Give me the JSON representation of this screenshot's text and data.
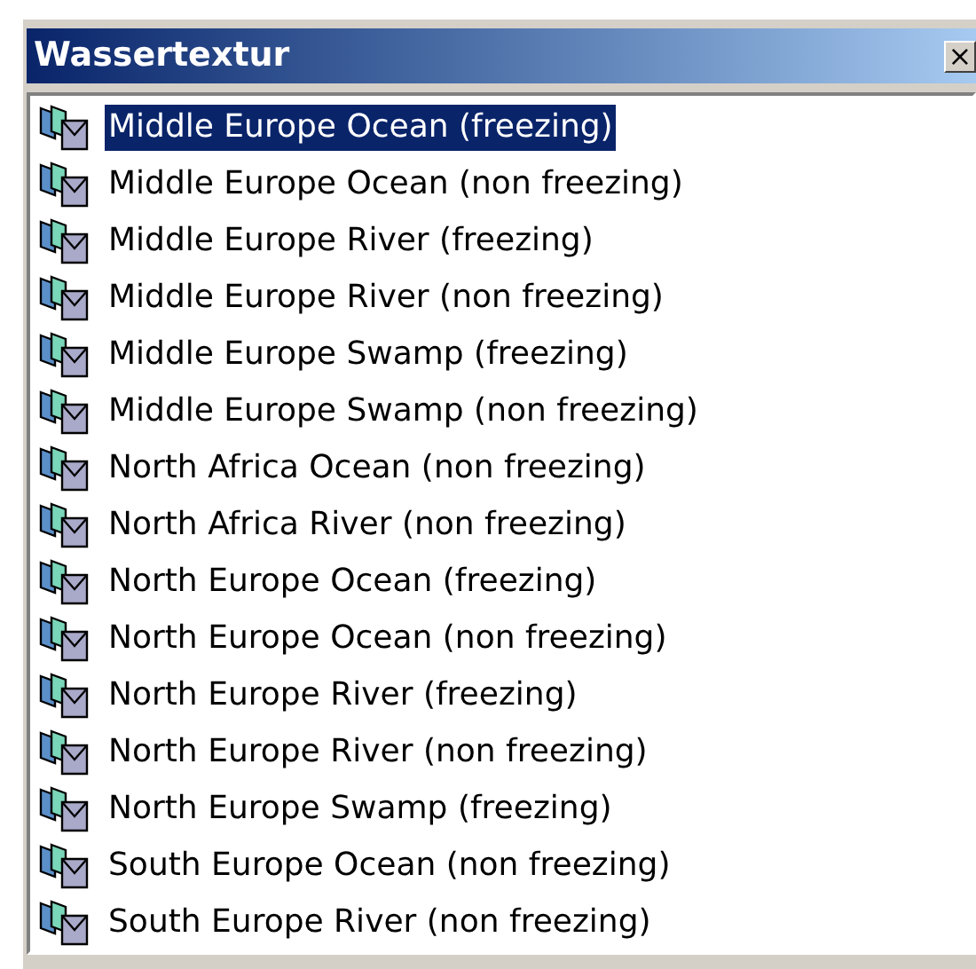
{
  "window": {
    "title": "Wassertextur",
    "close": "×"
  },
  "items": [
    {
      "label": "Middle Europe Ocean (freezing)",
      "selected": true
    },
    {
      "label": "Middle Europe Ocean (non freezing)",
      "selected": false
    },
    {
      "label": "Middle Europe River (freezing)",
      "selected": false
    },
    {
      "label": "Middle Europe River (non freezing)",
      "selected": false
    },
    {
      "label": "Middle Europe Swamp (freezing)",
      "selected": false
    },
    {
      "label": "Middle Europe Swamp (non freezing)",
      "selected": false
    },
    {
      "label": "North Africa Ocean (non freezing)",
      "selected": false
    },
    {
      "label": "North Africa River (non freezing)",
      "selected": false
    },
    {
      "label": "North Europe Ocean (freezing)",
      "selected": false
    },
    {
      "label": "North Europe Ocean (non freezing)",
      "selected": false
    },
    {
      "label": "North Europe River (freezing)",
      "selected": false
    },
    {
      "label": "North Europe River (non freezing)",
      "selected": false
    },
    {
      "label": "North Europe Swamp (freezing)",
      "selected": false
    },
    {
      "label": "South Europe Ocean (non freezing)",
      "selected": false
    },
    {
      "label": "South Europe River (non freezing)",
      "selected": false
    }
  ]
}
